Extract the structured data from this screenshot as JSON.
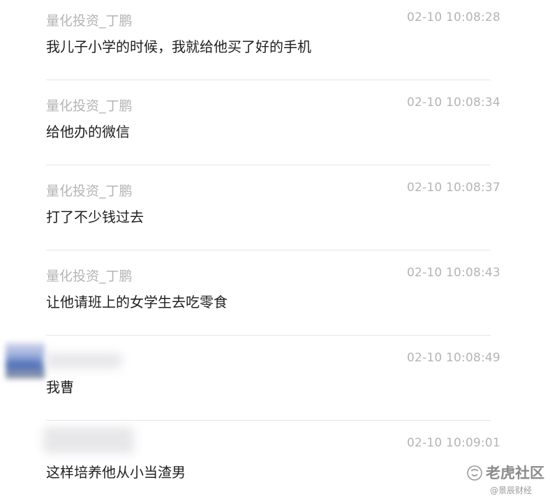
{
  "messages": [
    {
      "author": "量化投资_丁鹏",
      "time": "02-10 10:08:28",
      "text": "我儿子小学的时候，我就给他买了好的手机"
    },
    {
      "author": "量化投资_丁鹏",
      "time": "02-10 10:08:34",
      "text": "给他办的微信"
    },
    {
      "author": "量化投资_丁鹏",
      "time": "02-10 10:08:37",
      "text": "打了不少钱过去"
    },
    {
      "author": "量化投资_丁鹏",
      "time": "02-10 10:08:43",
      "text": "让他请班上的女学生去吃零食"
    },
    {
      "author": "",
      "time": "02-10 10:08:49",
      "text": "我曹"
    },
    {
      "author": "",
      "time": "02-10 10:09:01",
      "text": "这样培养他从小当渣男"
    }
  ],
  "watermark": {
    "title": "老虎社区",
    "subtitle": "@景辰财经"
  }
}
